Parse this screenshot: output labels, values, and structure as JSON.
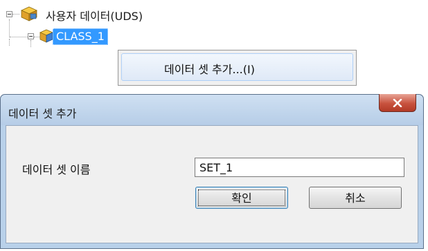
{
  "tree": {
    "root_label": "사용자 데이터(UDS)",
    "child_label": "CLASS_1"
  },
  "context_menu": {
    "add_dataset_label": "데이터 셋 추가...(I)"
  },
  "dialog": {
    "title": "데이터 셋 추가",
    "close_glyph": "x",
    "field_label": "데이터 셋 이름",
    "name_value": "SET_1",
    "ok_label": "확인",
    "cancel_label": "취소"
  },
  "colors": {
    "selection": "#3399ff",
    "close_button": "#c8523e",
    "dialog_frame": "#b9d1ea",
    "client_bg": "#f0f0f0"
  },
  "icons": {
    "tree_node": "cube-icon",
    "expander": "minus-expander-icon",
    "close": "close-icon"
  }
}
